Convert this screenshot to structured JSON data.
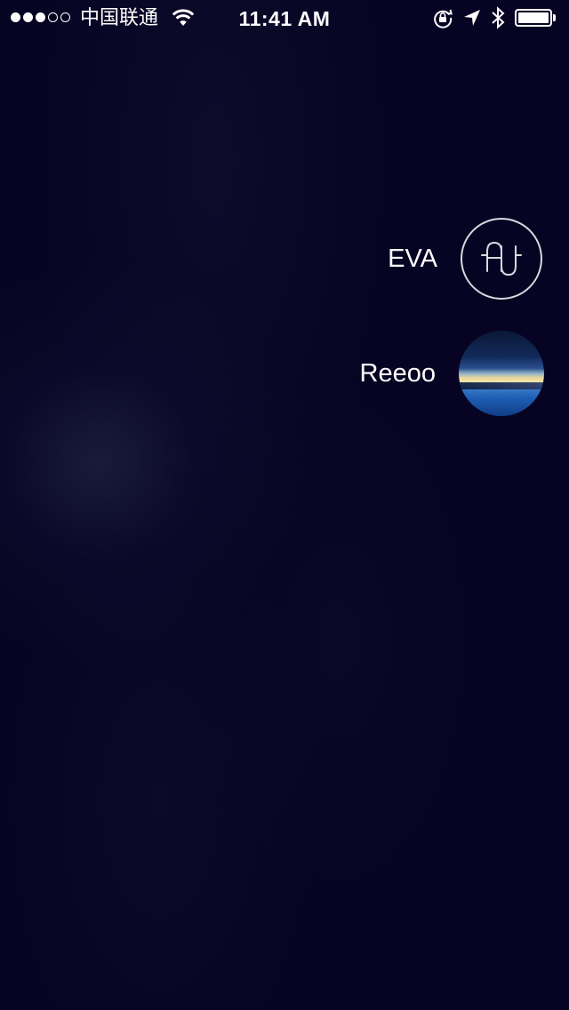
{
  "status_bar": {
    "signal_bars": 3,
    "signal_total": 5,
    "carrier": "中国联通",
    "time": "11:41 AM",
    "icons": [
      "wifi-icon",
      "rotation-lock-icon",
      "location-arrow-icon",
      "bluetooth-icon",
      "battery-icon"
    ],
    "battery_level": 1.0
  },
  "accounts": [
    {
      "name": "EVA",
      "avatar": "eva-monogram-logo"
    },
    {
      "name": "Reeoo",
      "avatar": "sunset-photo"
    }
  ],
  "colors": {
    "background": "#070423",
    "text": "#ffffff",
    "logo_ring": "#d8d8e0"
  }
}
